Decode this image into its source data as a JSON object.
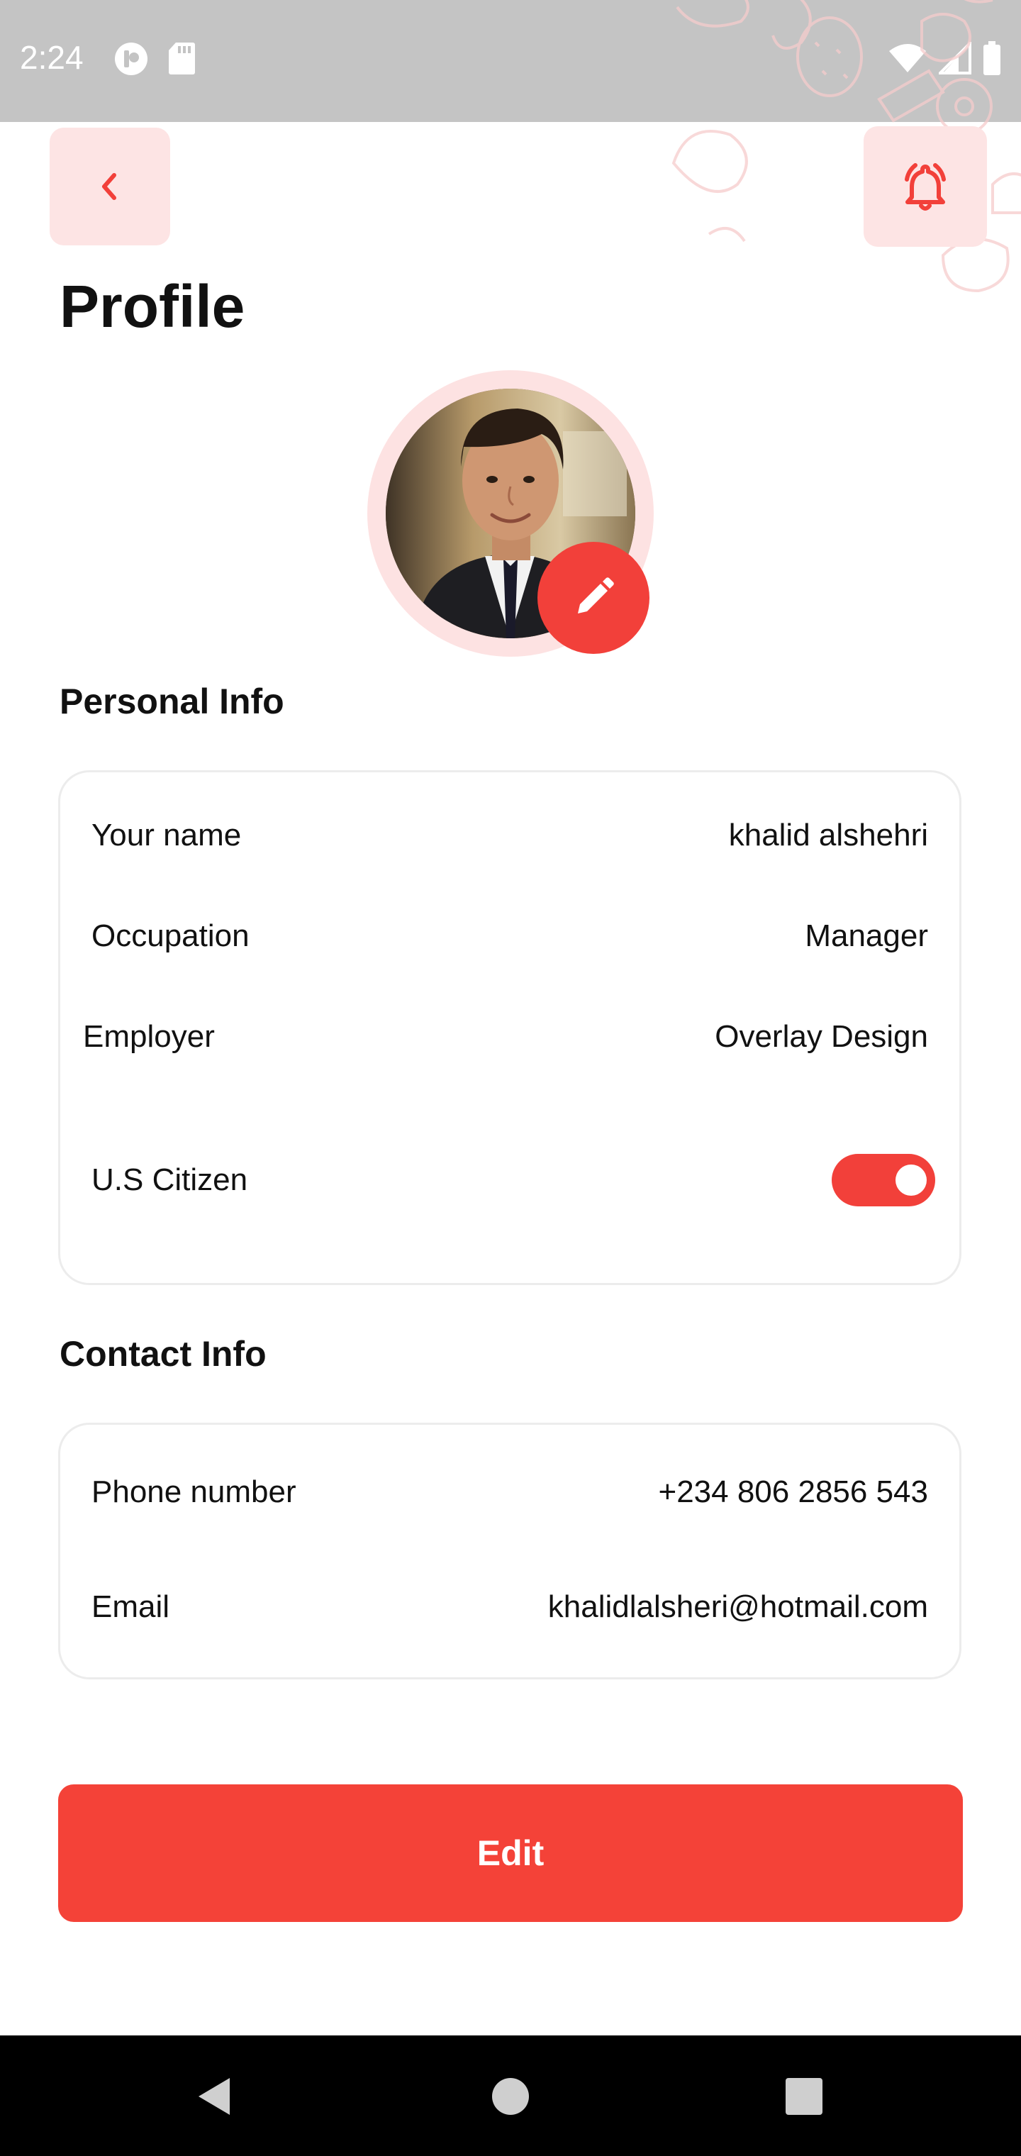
{
  "status_bar": {
    "time": "2:24"
  },
  "header": {
    "title": "Profile"
  },
  "icons": {
    "back": "chevron-left-icon",
    "bell": "bell-ringing-icon",
    "edit_photo": "pencil-icon"
  },
  "personal_info": {
    "title": "Personal Info",
    "rows": [
      {
        "label": "Your name",
        "value": "khalid alshehri"
      },
      {
        "label": "Occupation",
        "value": "Manager"
      },
      {
        "label": "Employer",
        "value": "Overlay Design"
      }
    ],
    "citizen": {
      "label": "U.S Citizen",
      "checked": true
    }
  },
  "contact_info": {
    "title": "Contact Info",
    "rows": [
      {
        "label": "Phone number",
        "value": "+234 806 2856 543"
      },
      {
        "label": "Email",
        "value": "khalidlalsheri@hotmail.com"
      }
    ]
  },
  "actions": {
    "edit_label": "Edit"
  },
  "colors": {
    "accent": "#f2403a",
    "accent_light": "#fde4e4"
  }
}
